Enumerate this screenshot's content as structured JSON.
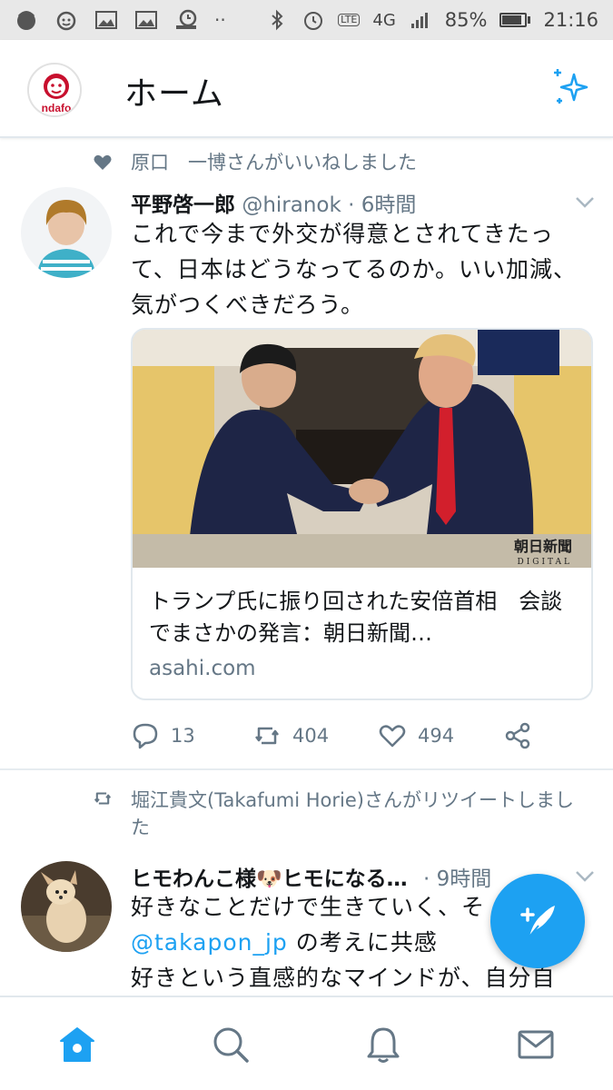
{
  "status_bar": {
    "battery": "85%",
    "time": "21:16",
    "network": "4G",
    "lte_label": "LTE",
    "icons": [
      "sad-face-icon",
      "alarm-clock-icon",
      "image-icon",
      "image-icon",
      "screen-record-icon",
      "more-dots-icon",
      "bluetooth-icon",
      "alarm-icon",
      "volte-icon",
      "network-4g-icon",
      "signal-icon",
      "battery-icon"
    ]
  },
  "header": {
    "title": "ホーム",
    "avatar_text": "ndafo",
    "sparkle_icon": "sparkle-icon"
  },
  "tweets": [
    {
      "context": "原口　一博さんがいいねしました",
      "context_icon": "heart-icon",
      "name": "平野啓一郎",
      "handle": "@hiranok · 6時間",
      "text": "これで今まで外交が得意とされてきたって、日本はどうなってるのか。いい加減、気がつくべきだろう。",
      "card": {
        "image_caption": "朝日新聞",
        "image_caption_sub": "DIGITAL",
        "title": "トランプ氏に振り回された安倍首相　会談でまさかの発言：朝日新聞…",
        "domain": "asahi.com"
      },
      "actions": {
        "reply_count": "13",
        "retweet_count": "404",
        "like_count": "494"
      }
    },
    {
      "context": "堀江貴文(Takafumi Horie)さんがリツイートしました",
      "context_icon": "retweet-icon",
      "name": "ヒモわんこ様🐶ヒモになる…",
      "handle": "· 9時間",
      "text_line1": "好きなことだけで生きていく、そ",
      "mention": "@takapon_jp",
      "text_line2_rest": " の考えに共感",
      "text_line3": "好きという直感的なマインドが、自分自"
    }
  ],
  "bottom_nav": {
    "items": [
      "home-icon",
      "search-icon",
      "notifications-icon",
      "messages-icon"
    ],
    "active": "home-icon"
  },
  "colors": {
    "accent": "#1da1f2",
    "secondary_text": "#657786",
    "primary_text": "#14171a"
  }
}
